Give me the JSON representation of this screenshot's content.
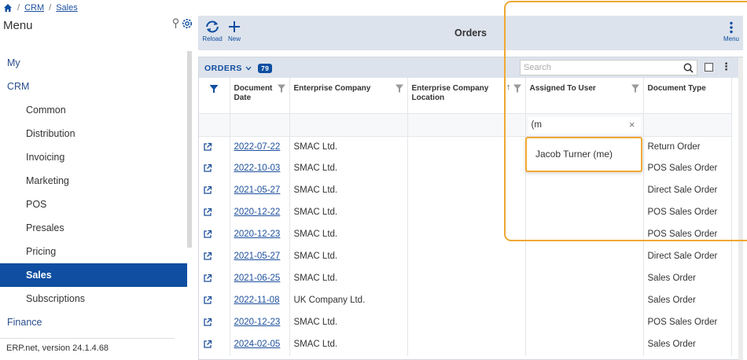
{
  "breadcrumb": {
    "items": [
      "CRM",
      "Sales"
    ]
  },
  "menu": {
    "title": "Menu",
    "items": [
      {
        "label": "My",
        "level": 0,
        "active": false
      },
      {
        "label": "CRM",
        "level": 0,
        "active": false
      },
      {
        "label": "Common",
        "level": 1,
        "active": false
      },
      {
        "label": "Distribution",
        "level": 1,
        "active": false
      },
      {
        "label": "Invoicing",
        "level": 1,
        "active": false
      },
      {
        "label": "Marketing",
        "level": 1,
        "active": false
      },
      {
        "label": "POS",
        "level": 1,
        "active": false
      },
      {
        "label": "Presales",
        "level": 1,
        "active": false
      },
      {
        "label": "Pricing",
        "level": 1,
        "active": false
      },
      {
        "label": "Sales",
        "level": 1,
        "active": true
      },
      {
        "label": "Subscriptions",
        "level": 1,
        "active": false
      },
      {
        "label": "Finance",
        "level": 0,
        "active": false
      }
    ],
    "version": "ERP.net, version 24.1.4.68"
  },
  "toolbar": {
    "reload_label": "Reload",
    "new_label": "New",
    "title": "Orders",
    "menu_label": "Menu"
  },
  "grid": {
    "name": "ORDERS",
    "count": "79",
    "search_placeholder": "Search",
    "columns": {
      "document_date": "Document Date",
      "enterprise_company": "Enterprise Company",
      "enterprise_company_location": "Enterprise Company Location",
      "assigned_to_user": "Assigned To User",
      "document_type": "Document Type"
    },
    "filter_assigned_value": "(m",
    "rows": [
      {
        "date": "2022-07-22",
        "company": "SMAC Ltd.",
        "location": "",
        "user": "",
        "type": "Return Order"
      },
      {
        "date": "2022-10-03",
        "company": "SMAC Ltd.",
        "location": "",
        "user": "",
        "type": "POS Sales Order"
      },
      {
        "date": "2021-05-27",
        "company": "SMAC Ltd.",
        "location": "",
        "user": "",
        "type": "Direct Sale Order"
      },
      {
        "date": "2020-12-22",
        "company": "SMAC Ltd.",
        "location": "",
        "user": "",
        "type": "POS Sales Order"
      },
      {
        "date": "2020-12-23",
        "company": "SMAC Ltd.",
        "location": "",
        "user": "",
        "type": "POS Sales Order"
      },
      {
        "date": "2021-05-27",
        "company": "SMAC Ltd.",
        "location": "",
        "user": "",
        "type": "Direct Sale Order"
      },
      {
        "date": "2021-06-25",
        "company": "SMAC Ltd.",
        "location": "",
        "user": "",
        "type": "Sales Order"
      },
      {
        "date": "2022-11-08",
        "company": "UK Company Ltd.",
        "location": "",
        "user": "",
        "type": "Sales Order"
      },
      {
        "date": "2020-12-23",
        "company": "SMAC Ltd.",
        "location": "",
        "user": "",
        "type": "POS Sales Order"
      },
      {
        "date": "2024-02-05",
        "company": "SMAC Ltd.",
        "location": "",
        "user": "",
        "type": "Sales Order"
      }
    ]
  },
  "dropdown": {
    "option": "Jacob Turner (me)"
  },
  "colors": {
    "accent": "#0f4ea1",
    "highlight": "#f0a833",
    "toolbar_bg": "#dde3ec"
  },
  "icons": [
    "home-icon",
    "pin-icon",
    "gear-icon",
    "reload-icon",
    "plus-icon",
    "kebab-icon",
    "filter-icon",
    "search-icon",
    "open-external-icon",
    "chevron-down-icon",
    "sort-up-icon",
    "close-icon"
  ]
}
